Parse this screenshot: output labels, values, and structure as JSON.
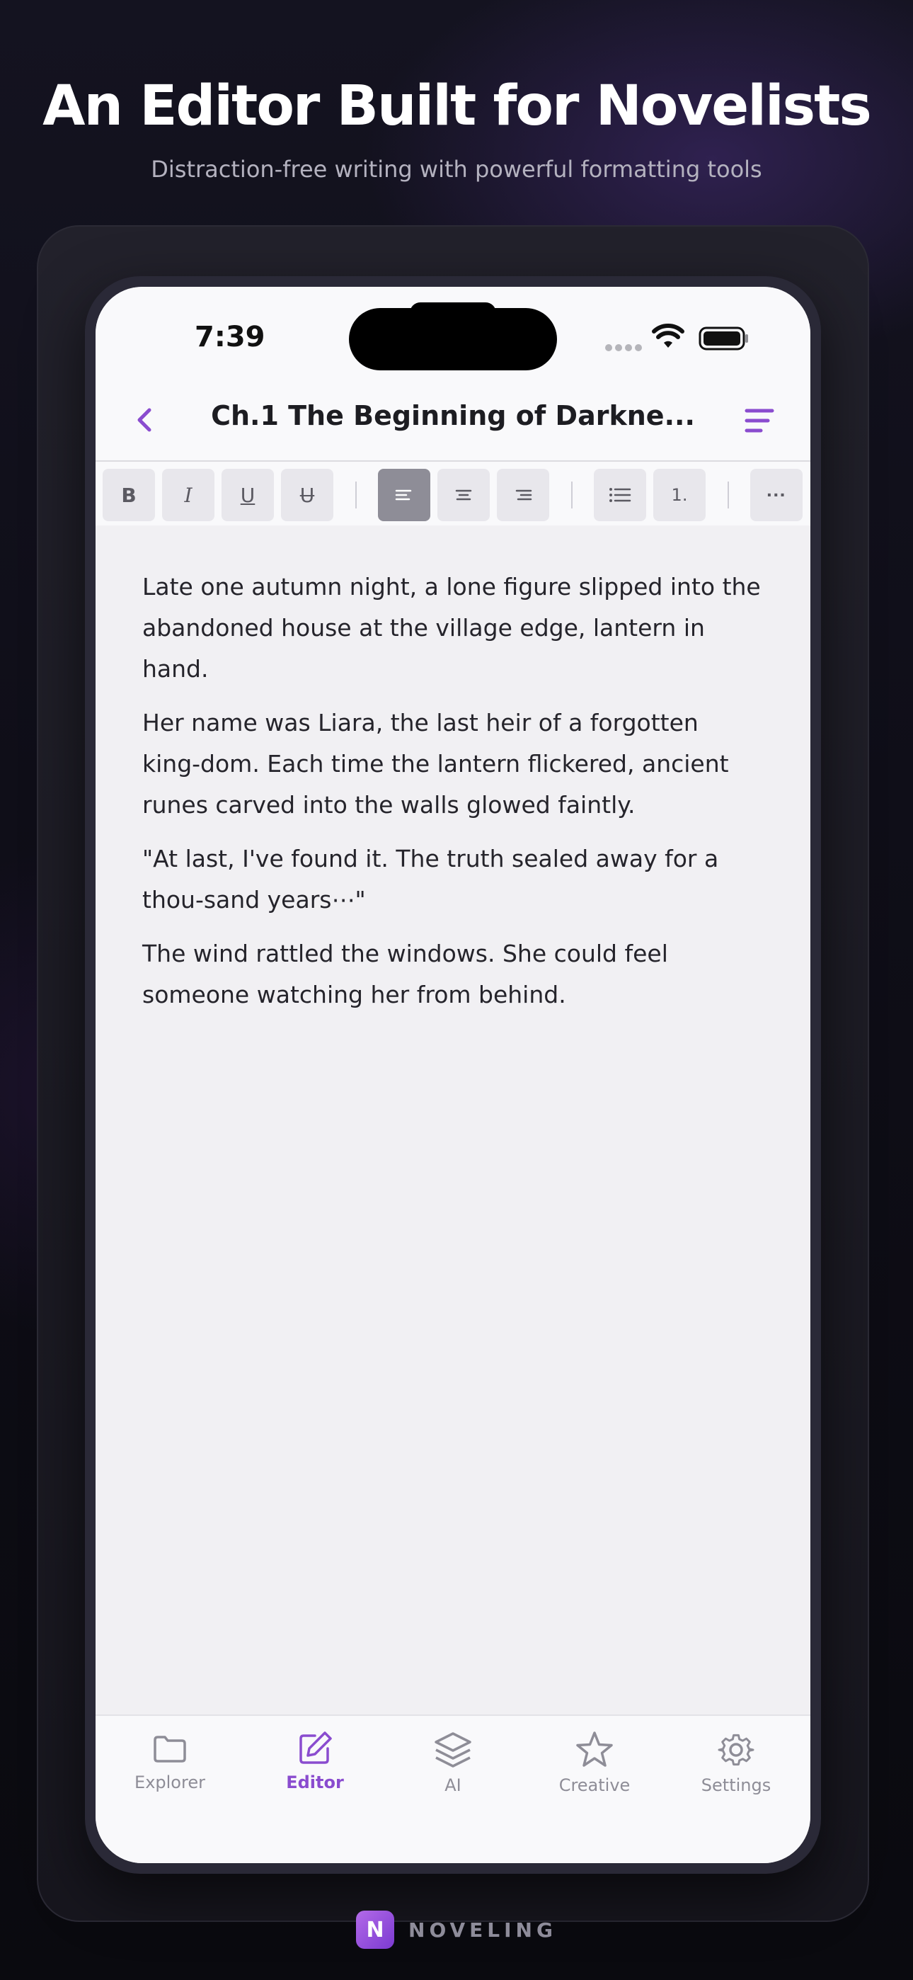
{
  "promo": {
    "headline": "An Editor Built for Novelists",
    "subline": "Distraction-free writing with powerful formatting tools"
  },
  "status": {
    "time": "7:39"
  },
  "nav": {
    "title": "Ch.1 The Beginning of Darkne..."
  },
  "toolbar": {
    "bold": "B",
    "italic": "I",
    "underline": "U",
    "strike": "U",
    "ordered_list": "1.",
    "more": "···",
    "active_alignment": "left"
  },
  "document": {
    "paragraphs": [
      "Late one autumn night, a lone figure slipped into the abandoned house at the village edge, lantern in hand.",
      "Her name was Liara, the last heir of a forgotten king-dom. Each time the lantern flickered, ancient runes carved into the walls glowed faintly.",
      "\"At last, I've found it. The truth sealed away for a thou-sand years⋯\"",
      "The wind rattled the windows. She could feel someone watching her from behind."
    ]
  },
  "tabs": [
    {
      "label": "Explorer",
      "icon": "folder-icon",
      "active": false
    },
    {
      "label": "Editor",
      "icon": "edit-icon",
      "active": true
    },
    {
      "label": "AI",
      "icon": "layers-icon",
      "active": false
    },
    {
      "label": "Creative",
      "icon": "star-icon",
      "active": false
    },
    {
      "label": "Settings",
      "icon": "gear-icon",
      "active": false
    }
  ],
  "brand": {
    "logo_letter": "N",
    "name": "NOVELING"
  },
  "colors": {
    "accent": "#8a4ccf",
    "inactive": "#8e8d97"
  }
}
